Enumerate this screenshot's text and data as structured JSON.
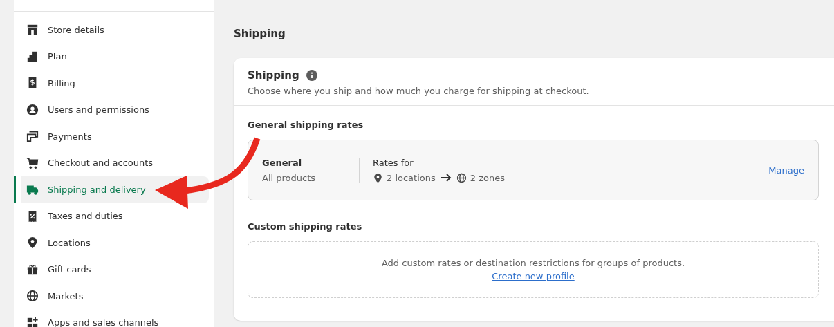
{
  "sidebar": {
    "items": [
      {
        "label": "Store details",
        "selected": false
      },
      {
        "label": "Plan",
        "selected": false
      },
      {
        "label": "Billing",
        "selected": false
      },
      {
        "label": "Users and permissions",
        "selected": false
      },
      {
        "label": "Payments",
        "selected": false
      },
      {
        "label": "Checkout and accounts",
        "selected": false
      },
      {
        "label": "Shipping and delivery",
        "selected": true
      },
      {
        "label": "Taxes and duties",
        "selected": false
      },
      {
        "label": "Locations",
        "selected": false
      },
      {
        "label": "Gift cards",
        "selected": false
      },
      {
        "label": "Markets",
        "selected": false
      },
      {
        "label": "Apps and sales channels",
        "selected": false
      }
    ]
  },
  "page_title": "Shipping",
  "card": {
    "title": "Shipping",
    "description": "Choose where you ship and how much you charge for shipping at checkout.",
    "general": {
      "heading": "General shipping rates",
      "profile_name": "General",
      "profile_scope": "All products",
      "rates_label": "Rates for",
      "locations": "2 locations",
      "zones": "2 zones",
      "action": "Manage"
    },
    "custom": {
      "heading": "Custom shipping rates",
      "message": "Add custom rates or destination restrictions for groups of products.",
      "link": "Create new profile"
    }
  }
}
